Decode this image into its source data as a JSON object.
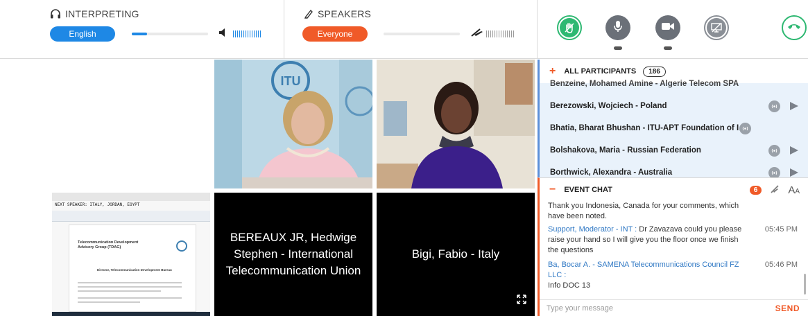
{
  "interpreting": {
    "title": "INTERPRETING",
    "language": "English",
    "volume": 0.2
  },
  "speakers": {
    "title": "SPEAKERS",
    "audience": "Everyone",
    "volume": 0.0
  },
  "controls": {
    "raise_hand_icon": "hand-icon",
    "mic_icon": "microphone-icon",
    "camera_icon": "camera-icon",
    "screen_share_icon": "screen-share-disabled-icon",
    "hangup_icon": "phone-hangup-icon",
    "accent_green": "#2eb872"
  },
  "videos": {
    "tile_left_label": "BEREAUX JR, Hedwige Stephen - International Telecommunication Union",
    "tile_right_label": "Bigi, Fabio - Italy",
    "document": {
      "header": "NEXT SPEAKER: ITALY, JORDAN, EGYPT",
      "title_line1": "Telecommunication Development",
      "title_line2": "Advisory Group (TDAG)",
      "subtitle": "Director, Telecommunication Development Bureau"
    }
  },
  "participants": {
    "title": "ALL PARTICIPANTS",
    "count": "186",
    "partial_top": "Benzeine, Mohamed Amine - Algerie Telecom SPA",
    "items": [
      "Berezowski, Wojciech - Poland",
      "Bhatia, Bharat Bhushan - ITU-APT Foundation of India",
      "Bolshakova, Maria - Russian Federation",
      "Borthwick, Alexandra - Australia"
    ]
  },
  "chat": {
    "title": "EVENT CHAT",
    "unread": "6",
    "font_size_label": "AA",
    "messages": [
      {
        "text": "Thank you Indonesia, Canada for your comments, which have been noted."
      },
      {
        "sender": "Support, Moderator - INT :",
        "text": "Dr Zavazava could you please raise your hand so I will give you the floor once we finish the questions",
        "time": "05:45 PM"
      },
      {
        "sender": "Ba, Bocar A. - SAMENA Telecommunications Council FZ LLC :",
        "text": "Info DOC 13",
        "time": "05:46 PM"
      }
    ],
    "placeholder": "Type your message",
    "send_label": "SEND"
  },
  "colors": {
    "blue": "#1e88e5",
    "orange": "#f05a28",
    "gray_button": "#6b7078"
  }
}
